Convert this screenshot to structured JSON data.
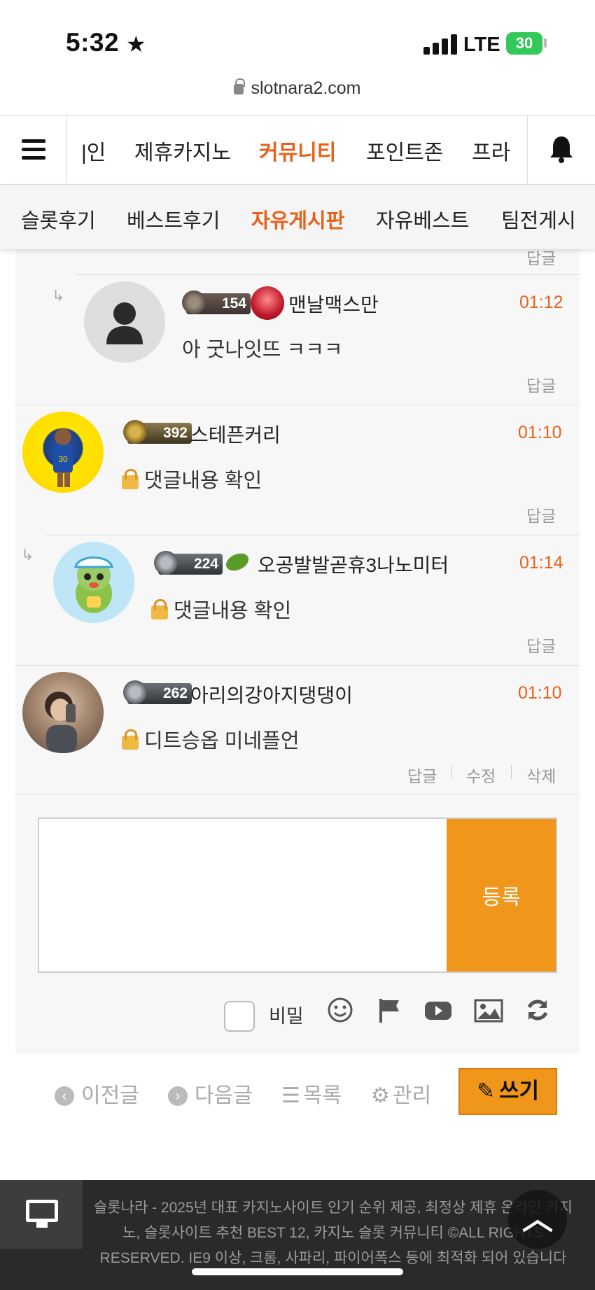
{
  "status": {
    "time": "5:32",
    "network": "LTE",
    "battery": "30"
  },
  "browser": {
    "url": "slotnara2.com"
  },
  "main_nav": {
    "items": [
      {
        "label": "|인"
      },
      {
        "label": "제휴카지노"
      },
      {
        "label": "커뮤니티",
        "active": true
      },
      {
        "label": "포인트존"
      },
      {
        "label": "프라"
      }
    ]
  },
  "sub_nav": {
    "items": [
      {
        "label": "슬롯후기"
      },
      {
        "label": "베스트후기"
      },
      {
        "label": "자유게시판",
        "active": true
      },
      {
        "label": "자유베스트"
      },
      {
        "label": "팀전게시"
      }
    ]
  },
  "comments": [
    {
      "level": "154",
      "nickname": "맨날맥스만",
      "time": "01:12",
      "text": "아 굿나잇뜨 ㅋㅋㅋ",
      "locked": false,
      "actions": [
        "답글"
      ]
    },
    {
      "level": "392",
      "nickname": "스테픈커리",
      "time": "01:10",
      "text": "댓글내용 확인",
      "locked": true,
      "actions": [
        "답글"
      ]
    },
    {
      "level": "224",
      "nickname": "오공발발곧휴3나노미터",
      "time": "01:14",
      "text": "댓글내용 확인",
      "locked": true,
      "actions": [
        "답글"
      ]
    },
    {
      "level": "262",
      "nickname": "아리의강아지댕댕이",
      "time": "01:10",
      "text": "디트승옵 미네플언",
      "locked": true,
      "actions": [
        "답글",
        "수정",
        "삭제"
      ]
    }
  ],
  "partial_reply_label": "답글",
  "write_box": {
    "submit_label": "등록",
    "secret_label": "비밀",
    "tools": [
      "emoji-icon",
      "flag-icon",
      "youtube-icon",
      "image-icon",
      "refresh-icon"
    ]
  },
  "bottom_nav": {
    "prev": "이전글",
    "next": "다음글",
    "list": "목록",
    "manage": "관리",
    "write": "쓰기"
  },
  "footer": {
    "text": "슬롯나라 - 2025년 대표 카지노사이트 인기 순위 제공, 최정상 제휴 온라인 카지노, 슬롯사이트 추천 BEST 12, 카지노 슬롯 커뮤니티 ©ALL RIGHTS RESERVED. IE9 이상, 크롬, 사파리, 파이어폭스 등에 최적화 되어 있습니다"
  },
  "colors": {
    "accent": "#e8611a",
    "button": "#f0961b",
    "footer_bg": "#2a2a2a"
  }
}
